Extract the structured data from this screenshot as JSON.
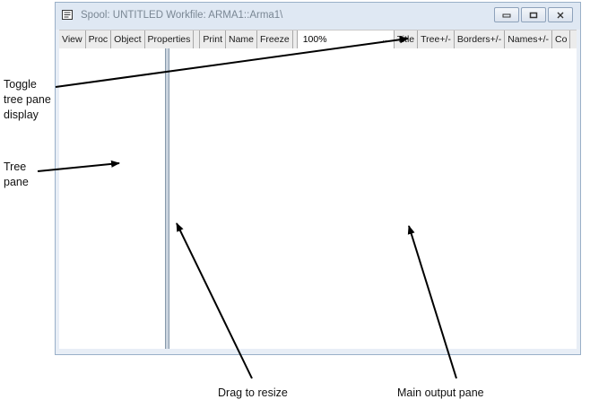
{
  "window": {
    "title": "Spool: UNTITLED    Workfile: ARMA1::Arma1\\"
  },
  "toolbar": {
    "buttons_left": [
      "View",
      "Proc",
      "Object",
      "Properties"
    ],
    "buttons_mid": [
      "Print",
      "Name",
      "Freeze"
    ],
    "zoom": "100%",
    "buttons_right": [
      "Title",
      "Tree+/-",
      "Borders+/-",
      "Names+/-",
      "Co"
    ]
  },
  "annotations": {
    "toggle_tree": [
      "Toggle",
      "tree pane",
      "display"
    ],
    "tree_pane": [
      "Tree",
      "pane"
    ],
    "drag_resize": "Drag to resize",
    "main_output": "Main output pane"
  },
  "icons": {
    "window_icon": "spool-window-icon",
    "minimize": "minimize-icon",
    "maximize": "maximize-icon",
    "close": "close-icon",
    "zoom_dropdown": "chevron-down-icon"
  },
  "colors": {
    "frame": "#dfe8f3",
    "splitter": "#c9d3de",
    "toolbar": "#ececec"
  }
}
